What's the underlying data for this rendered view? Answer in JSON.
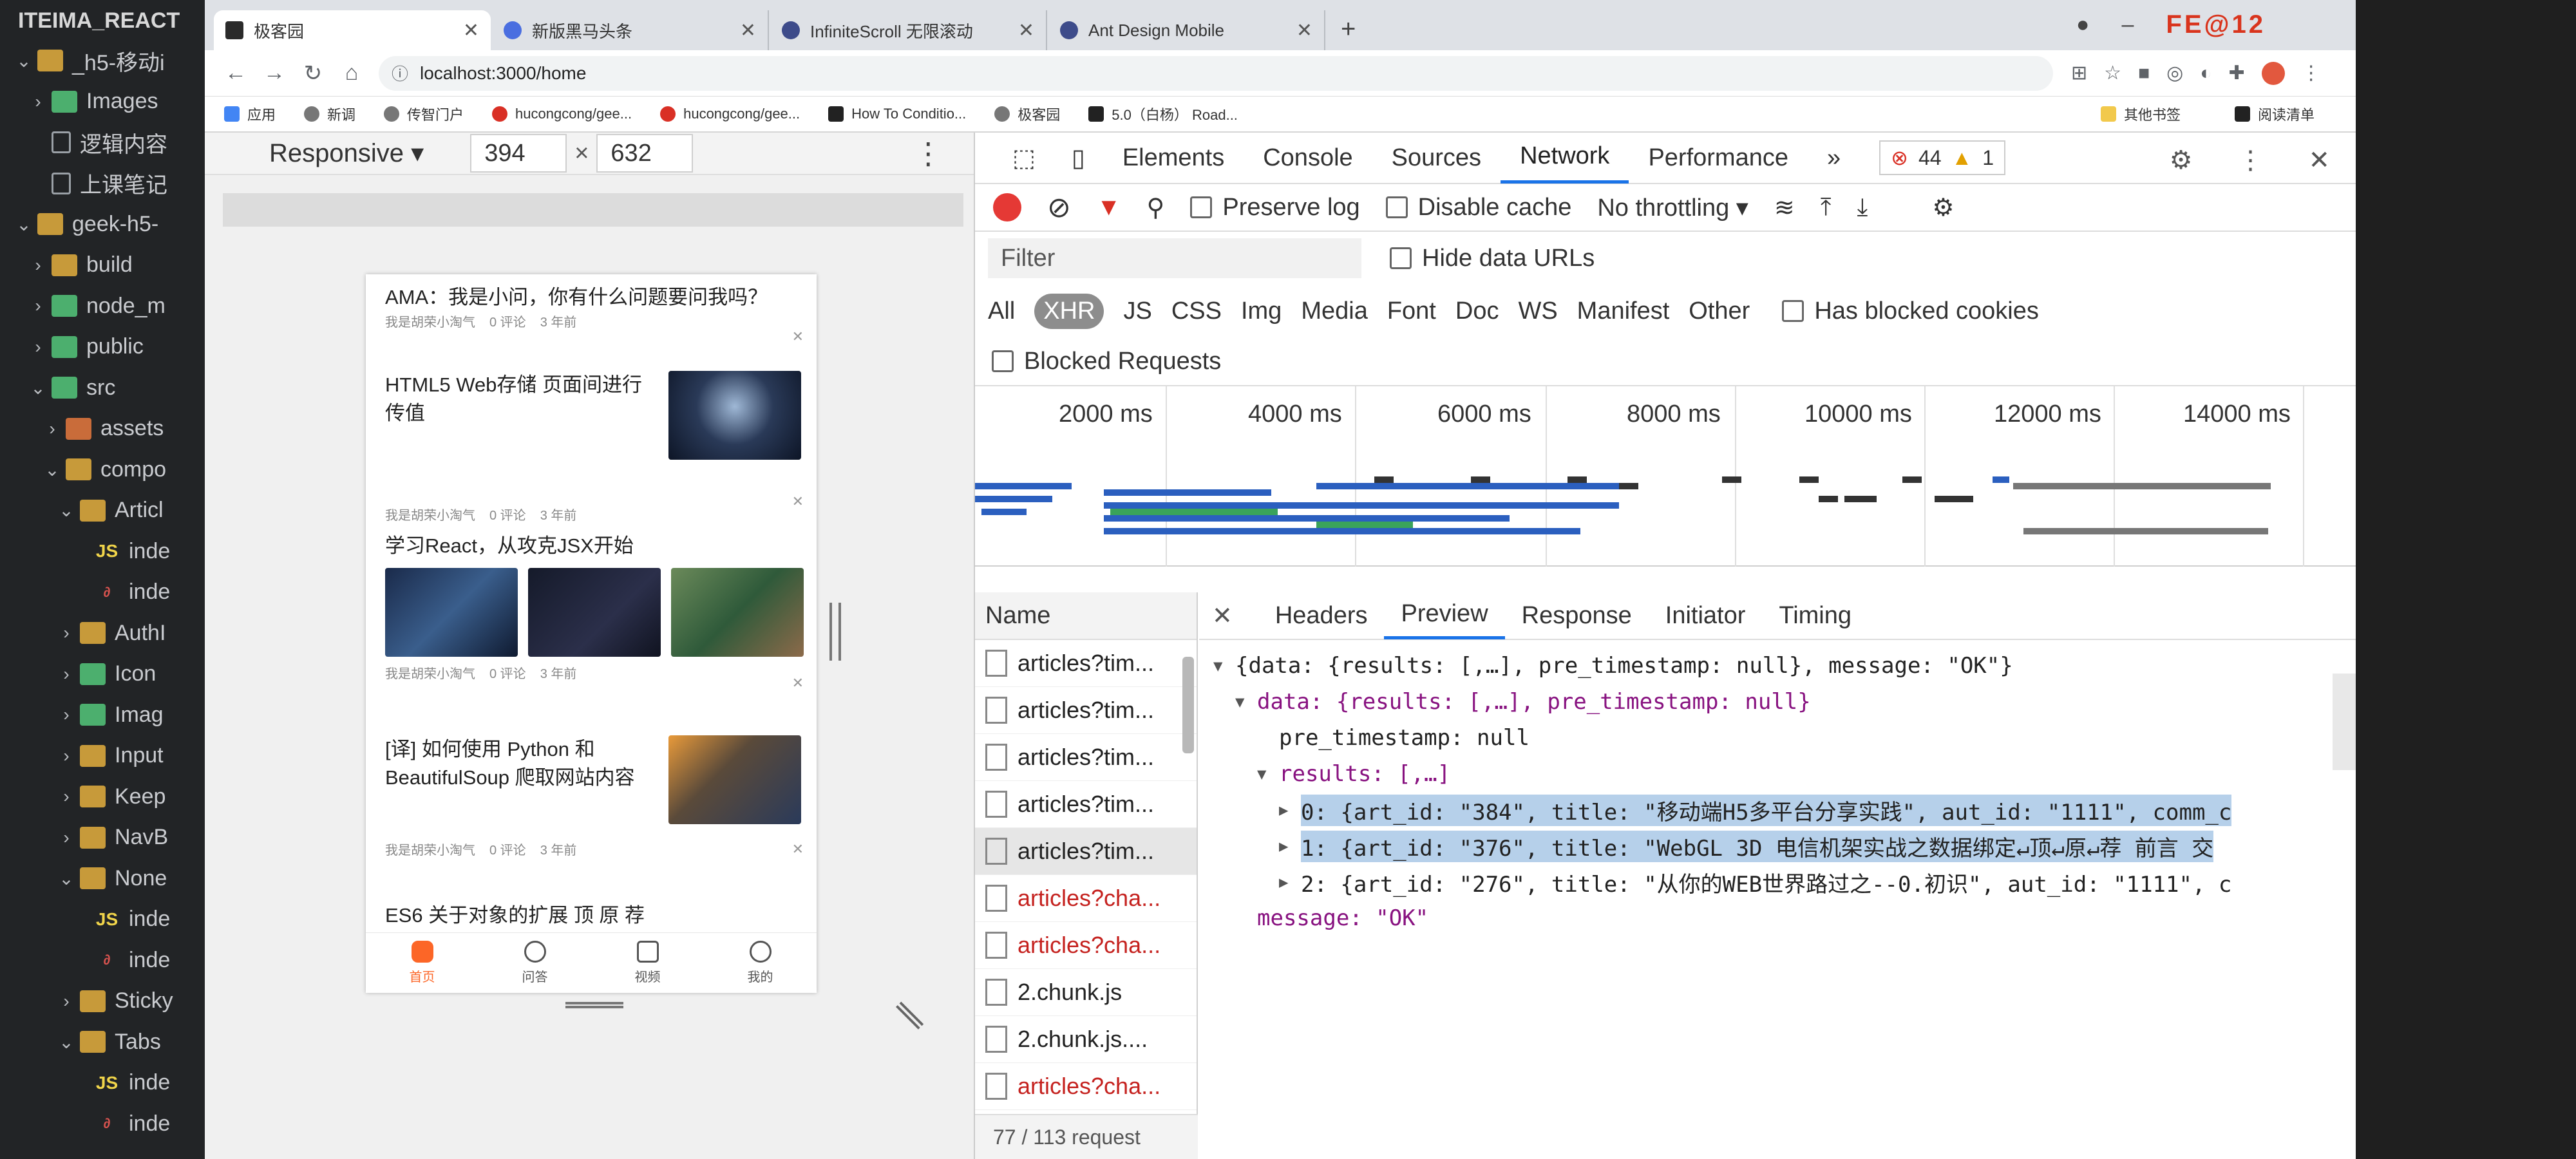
{
  "explorer": {
    "root": "ITEIMA_REACT",
    "items": [
      {
        "label": "_h5-移动i",
        "kind": "folder",
        "chev": "⌄",
        "indent": 1
      },
      {
        "label": "Images",
        "kind": "folder-green",
        "chev": "›",
        "indent": 2
      },
      {
        "label": "逻辑内容",
        "kind": "doc",
        "chev": "",
        "indent": 2
      },
      {
        "label": "上课笔记",
        "kind": "doc",
        "chev": "",
        "indent": 2
      },
      {
        "label": "geek-h5-",
        "kind": "folder",
        "chev": "⌄",
        "indent": 1
      },
      {
        "label": "build",
        "kind": "folder",
        "chev": "›",
        "indent": 2
      },
      {
        "label": "node_m",
        "kind": "folder-green",
        "chev": "›",
        "indent": 2
      },
      {
        "label": "public",
        "kind": "folder-green",
        "chev": "›",
        "indent": 2
      },
      {
        "label": "src",
        "kind": "folder-green",
        "chev": "⌄",
        "indent": 2
      },
      {
        "label": "assets",
        "kind": "folder-orange",
        "chev": "›",
        "indent": 3
      },
      {
        "label": "compo",
        "kind": "folder",
        "chev": "⌄",
        "indent": 3
      },
      {
        "label": "Articl",
        "kind": "folder",
        "chev": "⌄",
        "indent": 4
      },
      {
        "label": "inde",
        "kind": "js",
        "chev": "",
        "indent": 5
      },
      {
        "label": "inde",
        "kind": "link",
        "chev": "",
        "indent": 5
      },
      {
        "label": "AuthI",
        "kind": "folder",
        "chev": "›",
        "indent": 4
      },
      {
        "label": "Icon",
        "kind": "folder-green",
        "chev": "›",
        "indent": 4
      },
      {
        "label": "Imag",
        "kind": "folder-green",
        "chev": "›",
        "indent": 4
      },
      {
        "label": "Input",
        "kind": "folder",
        "chev": "›",
        "indent": 4
      },
      {
        "label": "Keep",
        "kind": "folder",
        "chev": "›",
        "indent": 4
      },
      {
        "label": "NavB",
        "kind": "folder",
        "chev": "›",
        "indent": 4
      },
      {
        "label": "None",
        "kind": "folder",
        "chev": "⌄",
        "indent": 4
      },
      {
        "label": "inde",
        "kind": "js",
        "chev": "",
        "indent": 5
      },
      {
        "label": "inde",
        "kind": "link",
        "chev": "",
        "indent": 5
      },
      {
        "label": "Sticky",
        "kind": "folder",
        "chev": "›",
        "indent": 4
      },
      {
        "label": "Tabs",
        "kind": "folder",
        "chev": "⌄",
        "indent": 4
      },
      {
        "label": "inde",
        "kind": "js",
        "chev": "",
        "indent": 5
      },
      {
        "label": "inde",
        "kind": "link",
        "chev": "",
        "indent": 5
      }
    ]
  },
  "browser": {
    "tabs": [
      {
        "label": "极客园",
        "fav": "sq"
      },
      {
        "label": "新版黑马头条",
        "fav": "blue"
      },
      {
        "label": "InfiniteScroll 无限滚动",
        "fav": ""
      },
      {
        "label": "Ant Design Mobile",
        "fav": ""
      }
    ],
    "new_tab": "+",
    "window_badge": "FE@12",
    "url": "localhost:3000/home",
    "bookmarks": [
      "应用",
      "新调",
      "传智门户",
      "hucongcong/gee...",
      "hucongcong/gee...",
      "How To Conditio...",
      "极客园",
      "5.0（白杨） Road..."
    ],
    "bookmarks_right": [
      "其他书签",
      "阅读清单"
    ]
  },
  "device": {
    "mode": "Responsive",
    "width": "394",
    "height": "632",
    "x": "×",
    "kebab": "⋮",
    "articles": [
      {
        "title": "AMA：我是小问，你有什么问题要问我吗？",
        "author": "我是胡荣小淘气",
        "comments": "0 评论",
        "time": "3 年前"
      },
      {
        "title": "HTML5 Web存储 页面间进行传值",
        "author": "我是胡荣小淘气",
        "comments": "0 评论",
        "time": "3 年前"
      },
      {
        "title": "学习React，从攻克JSX开始",
        "author": "我是胡荣小淘气",
        "comments": "0 评论",
        "time": "3 年前"
      },
      {
        "title": "[译] 如何使用 Python 和 BeautifulSoup 爬取网站内容",
        "author": "我是胡荣小淘气",
        "comments": "0 评论",
        "time": "3 年前"
      },
      {
        "title": "ES6 关于对象的扩展 顶 原 荐",
        "author": "",
        "comments": "",
        "time": ""
      }
    ],
    "tabbar": [
      "首页",
      "问答",
      "视频",
      "我的"
    ]
  },
  "devtools": {
    "tabs": [
      "Elements",
      "Console",
      "Sources",
      "Network",
      "Performance"
    ],
    "more": "»",
    "errors": "44",
    "warnings": "1",
    "preserve_log": "Preserve log",
    "disable_cache": "Disable cache",
    "throttling": "No throttling",
    "filter_placeholder": "Filter",
    "hide_data_urls": "Hide data URLs",
    "types": [
      "All",
      "XHR",
      "JS",
      "CSS",
      "Img",
      "Media",
      "Font",
      "Doc",
      "WS",
      "Manifest",
      "Other"
    ],
    "has_blocked_cookies": "Has blocked cookies",
    "blocked_requests": "Blocked Requests",
    "timeline_labels": [
      "2000 ms",
      "4000 ms",
      "6000 ms",
      "8000 ms",
      "10000 ms",
      "12000 ms",
      "14000 ms"
    ],
    "name_header": "Name",
    "requests": [
      {
        "name": "articles?tim...",
        "red": false,
        "sel": false
      },
      {
        "name": "articles?tim...",
        "red": false,
        "sel": false
      },
      {
        "name": "articles?tim...",
        "red": false,
        "sel": false
      },
      {
        "name": "articles?tim...",
        "red": false,
        "sel": false
      },
      {
        "name": "articles?tim...",
        "red": false,
        "sel": true
      },
      {
        "name": "articles?cha...",
        "red": true,
        "sel": false
      },
      {
        "name": "articles?cha...",
        "red": true,
        "sel": false
      },
      {
        "name": "2.chunk.js",
        "red": false,
        "sel": false
      },
      {
        "name": "2.chunk.js....",
        "red": false,
        "sel": false
      },
      {
        "name": "articles?cha...",
        "red": true,
        "sel": false
      }
    ],
    "request_count": "77 / 113 request",
    "detail_tabs": [
      "Headers",
      "Preview",
      "Response",
      "Initiator",
      "Timing"
    ],
    "preview": {
      "l1": "{data: {results: [,…], pre_timestamp: null}, message: \"OK\"}",
      "l2": "data: {results: [,…], pre_timestamp: null}",
      "l3": "pre_timestamp: null",
      "l4": "results: [,…]",
      "r0": "0: {art_id: \"384\", title: \"移动端H5多平台分享实践\", aut_id: \"1111\", comm_c",
      "r1": "1: {art_id: \"376\", title: \"WebGL 3D 电信机架实战之数据绑定↵顶↵原↵荐 前言 交",
      "r2": "2: {art_id: \"276\", title: \"从你的WEB世界路过之--0.初识\", aut_id: \"1111\", c",
      "l5": "message: \"OK\""
    }
  }
}
